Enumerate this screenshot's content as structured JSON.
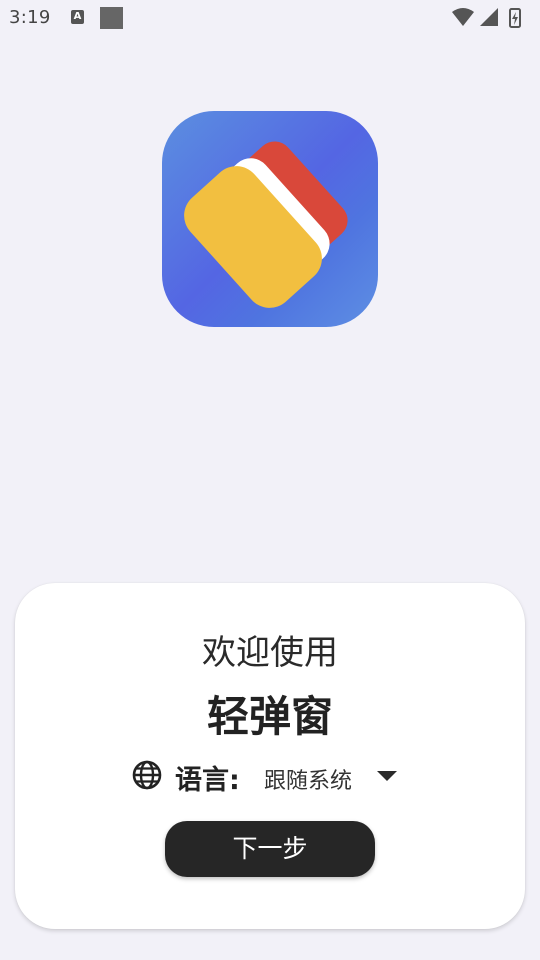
{
  "status_bar": {
    "time": "3:19",
    "notification_letter": "A"
  },
  "welcome": {
    "greeting": "欢迎使用",
    "app_name": "轻弹窗",
    "language_label": "语言:",
    "language_value": "跟随系统",
    "next_button": "下一步"
  },
  "icons": {
    "language": "globe-icon",
    "dropdown": "caret-down-icon",
    "wifi": "wifi-icon",
    "signal": "signal-icon",
    "battery": "battery-charging-icon"
  }
}
